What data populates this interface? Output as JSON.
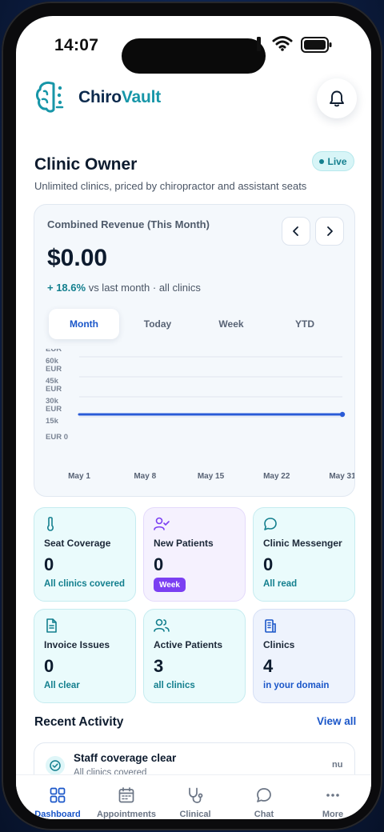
{
  "status_bar": {
    "time": "14:07"
  },
  "brand": {
    "name_part1": "Chiro",
    "name_part2": "Vault"
  },
  "page": {
    "title": "Clinic Owner",
    "badge": "Live",
    "subtitle": "Unlimited clinics, priced by chiropractor and assistant seats"
  },
  "revenue": {
    "label": "Combined Revenue (This Month)",
    "value": "$0.00",
    "delta_value": "+ 18.6%",
    "delta_text": " vs last month · all clinics",
    "tabs": [
      "Month",
      "Today",
      "Week",
      "YTD"
    ],
    "active_tab": "Month"
  },
  "chart_data": {
    "type": "line",
    "x": [
      "May 1",
      "May 8",
      "May 15",
      "May 22",
      "May 31"
    ],
    "series": [
      {
        "values": [
          0,
          0,
          0,
          0,
          0
        ]
      }
    ],
    "y_ticks": [
      "EUR 60k",
      "EUR 45k",
      "EUR 30k",
      "EUR 15k",
      "EUR 0"
    ],
    "ylim": [
      0,
      60000
    ],
    "grid": true,
    "color": "#2a5bd7"
  },
  "stats": [
    {
      "title": "Seat Coverage",
      "value": "0",
      "sub": "All clinics covered",
      "icon": "thermometer-icon"
    },
    {
      "title": "New Patients",
      "value": "0",
      "sub": "Week",
      "icon": "user-check-icon"
    },
    {
      "title": "Clinic Messenger",
      "value": "0",
      "sub": "All read",
      "icon": "message-icon"
    },
    {
      "title": "Invoice Issues",
      "value": "0",
      "sub": "All clear",
      "icon": "file-text-icon"
    },
    {
      "title": "Active Patients",
      "value": "3",
      "sub": "all clinics",
      "icon": "users-icon"
    },
    {
      "title": "Clinics",
      "value": "4",
      "sub": "in your domain",
      "icon": "building-icon"
    }
  ],
  "activity": {
    "title": "Recent Activity",
    "view_all": "View all",
    "items": [
      {
        "title": "Staff coverage clear",
        "sub": "All clinics covered",
        "time": "nu"
      }
    ]
  },
  "tabbar": {
    "items": [
      {
        "label": "Dashboard",
        "icon": "grid-icon"
      },
      {
        "label": "Appointments",
        "icon": "calendar-icon"
      },
      {
        "label": "Clinical",
        "icon": "stethoscope-icon"
      },
      {
        "label": "Chat",
        "icon": "chat-icon"
      },
      {
        "label": "More",
        "icon": "more-icon"
      }
    ],
    "active": "Dashboard"
  },
  "colors": {
    "brand_dark": "#0c2a4d",
    "brand_teal": "#1796a8",
    "accent_blue": "#1a56c9",
    "teal_text": "#137f8e",
    "purple": "#7b3ff2"
  }
}
